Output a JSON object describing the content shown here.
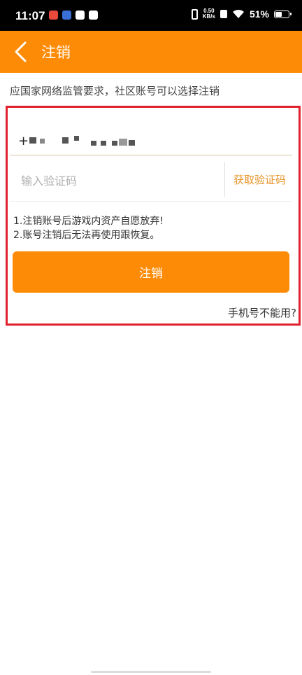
{
  "status_bar": {
    "time": "11:07",
    "speed_top": "0.50",
    "speed_bottom": "KB/s",
    "battery": "51%",
    "battery_level": 0.51,
    "icons": [
      "notification-app-icon",
      "notification-game-icon",
      "mail-icon",
      "message-icon",
      "vibrate-icon",
      "network-speed-icon",
      "nfc-icon",
      "wifi-icon",
      "battery-icon"
    ]
  },
  "header": {
    "title": "注销",
    "back_icon": "chevron-left-icon",
    "background_color": "#fe8b06"
  },
  "notice": "应国家网络监管要求，社区账号可以选择注销",
  "form": {
    "phone_prefix": "+",
    "code_placeholder": "输入验证码",
    "get_code_label": "获取验证码",
    "warnings": [
      "1.注销账号后游戏内资产自愿放弃!",
      "2.账号注销后无法再使用跟恢复。"
    ],
    "submit_label": "注销",
    "phone_unusable_link": "手机号不能用?",
    "accent_color": "#e8952a",
    "highlight_border_color": "#e0222e"
  }
}
